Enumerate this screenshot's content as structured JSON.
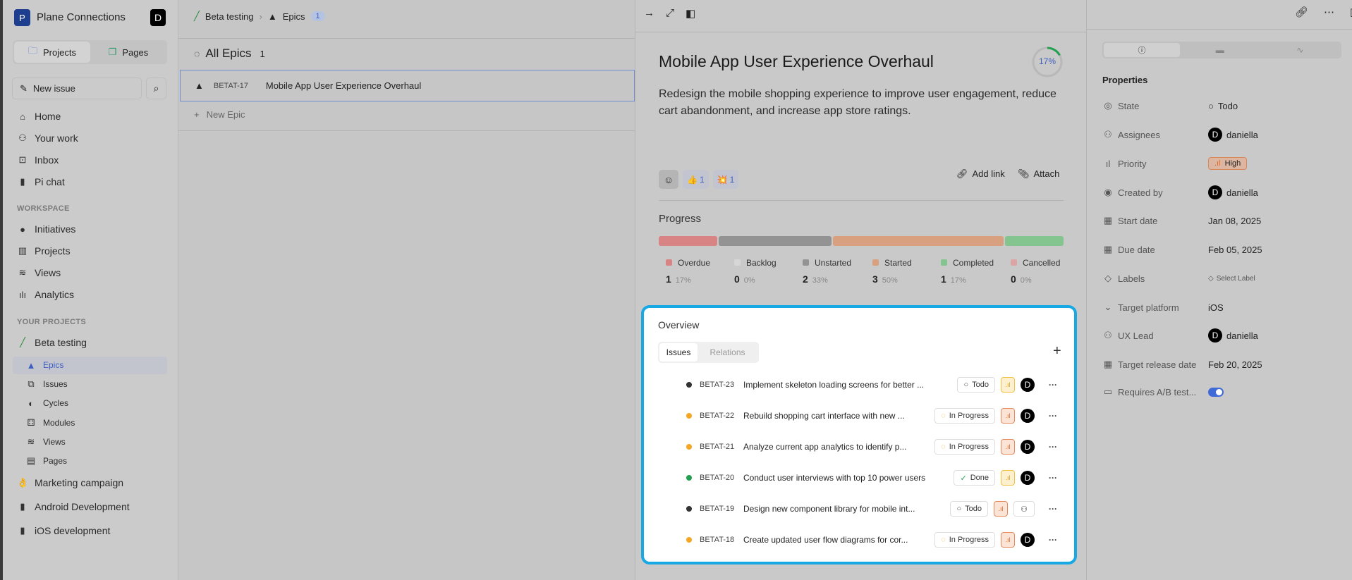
{
  "sidebar": {
    "workspace": "Plane Connections",
    "workspace_initial": "P",
    "user_initial": "D",
    "tabs": [
      "Projects",
      "Pages"
    ],
    "new_issue": "New issue",
    "nav": [
      "Home",
      "Your work",
      "Inbox",
      "Pi chat"
    ],
    "workspace_label": "WORKSPACE",
    "workspace_items": [
      "Initiatives",
      "Projects",
      "Views",
      "Analytics"
    ],
    "projects_label": "YOUR PROJECTS",
    "project": "Beta testing",
    "project_items": [
      "Epics",
      "Issues",
      "Cycles",
      "Modules",
      "Views",
      "Pages"
    ],
    "other_projects": [
      "Marketing campaign",
      "Android Development",
      "iOS development"
    ]
  },
  "main": {
    "breadcrumb": [
      "Beta testing",
      "Epics"
    ],
    "epics_count": "1",
    "header": "All Epics",
    "header_count": "1",
    "epic": {
      "id": "BETAT-17",
      "title": "Mobile App User Experience Overhaul"
    },
    "new_epic": "New Epic"
  },
  "detail": {
    "title": "Mobile App User Experience Overhaul",
    "progress_pct": "17%",
    "progress_value": 17,
    "description": "Redesign the mobile shopping experience to improve user engagement, reduce cart abandonment, and increase app store ratings.",
    "reactions": [
      {
        "emoji": "👍",
        "count": "1"
      },
      {
        "emoji": "💥",
        "count": "1"
      }
    ],
    "add_link": "Add link",
    "attach": "Attach",
    "progress_label": "Progress",
    "legend": [
      {
        "label": "Overdue",
        "count": "1",
        "pct": "17%",
        "color": "#d98484"
      },
      {
        "label": "Backlog",
        "count": "0",
        "pct": "0%",
        "color": "#d6d6d6"
      },
      {
        "label": "Unstarted",
        "count": "2",
        "pct": "33%",
        "color": "#939393"
      },
      {
        "label": "Started",
        "count": "3",
        "pct": "50%",
        "color": "#d9a07f"
      },
      {
        "label": "Completed",
        "count": "1",
        "pct": "17%",
        "color": "#84c48e"
      },
      {
        "label": "Cancelled",
        "count": "0",
        "pct": "0%",
        "color": "#dca5a5"
      }
    ]
  },
  "overview": {
    "title": "Overview",
    "tabs": [
      "Issues",
      "Relations"
    ],
    "issues": [
      {
        "id": "BETAT-23",
        "title": "Implement skeleton loading screens for better ...",
        "state": "Todo",
        "dot": "#333333",
        "prio": "medium",
        "assignee": "D"
      },
      {
        "id": "BETAT-22",
        "title": "Rebuild shopping cart interface with new ...",
        "state": "In Progress",
        "dot": "#f5a623",
        "prio": "high",
        "assignee": "D"
      },
      {
        "id": "BETAT-21",
        "title": "Analyze current app analytics to identify p...",
        "state": "In Progress",
        "dot": "#f5a623",
        "prio": "high",
        "assignee": "D"
      },
      {
        "id": "BETAT-20",
        "title": "Conduct user interviews with top 10 power users",
        "state": "Done",
        "dot": "#22a050",
        "prio": "medium",
        "assignee": "D"
      },
      {
        "id": "BETAT-19",
        "title": "Design new component library for mobile int...",
        "state": "Todo",
        "dot": "#333333",
        "prio": "high",
        "assignee": ""
      },
      {
        "id": "BETAT-18",
        "title": "Create updated user flow diagrams for cor...",
        "state": "In Progress",
        "dot": "#f5a623",
        "prio": "high",
        "assignee": "D"
      }
    ]
  },
  "properties": {
    "title": "Properties",
    "rows": [
      {
        "label": "State",
        "value": "Todo"
      },
      {
        "label": "Assignees",
        "value": "daniella"
      },
      {
        "label": "Priority",
        "value": "High"
      },
      {
        "label": "Created by",
        "value": "daniella"
      },
      {
        "label": "Start date",
        "value": "Jan 08, 2025"
      },
      {
        "label": "Due date",
        "value": "Feb 05, 2025"
      },
      {
        "label": "Labels",
        "value": "Select Label"
      },
      {
        "label": "Target platform",
        "value": "iOS"
      },
      {
        "label": "UX Lead",
        "value": "daniella"
      },
      {
        "label": "Target release date",
        "value": "Feb 20, 2025"
      },
      {
        "label": "Requires A/B test...",
        "value_toggle": true
      }
    ]
  },
  "colors": {
    "accent": "#3f6ad8",
    "highlight": "#18a8e3"
  }
}
